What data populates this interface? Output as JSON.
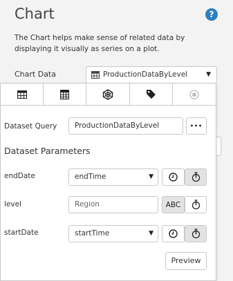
{
  "panel": {
    "title": "Chart",
    "help_icon": "question-circle-icon",
    "help_glyph": "?",
    "description": "The Chart helps make sense of related data by displaying it visually as series on a plot.",
    "chart_data_label": "Chart Data",
    "chart_data_value": "ProductionDataByLevel"
  },
  "popup": {
    "tabs": [
      {
        "icon": "table-icon",
        "active": true
      },
      {
        "icon": "calculator-icon",
        "active": false
      },
      {
        "icon": "network-icon",
        "active": false
      },
      {
        "icon": "tag-icon",
        "active": false
      },
      {
        "icon": "radio-icon",
        "active": false,
        "disabled": true
      }
    ],
    "dataset_query_label": "Dataset Query",
    "dataset_query_value": "ProductionDataByLevel",
    "more_label": "•••",
    "params_title": "Dataset Parameters",
    "params": [
      {
        "label": "endDate",
        "value": "endTime",
        "kind": "select"
      },
      {
        "label": "level",
        "value": "Region",
        "kind": "text",
        "mode_label": "ABC"
      },
      {
        "label": "startDate",
        "value": "startTime",
        "kind": "select"
      }
    ],
    "preview_label": "Preview"
  }
}
